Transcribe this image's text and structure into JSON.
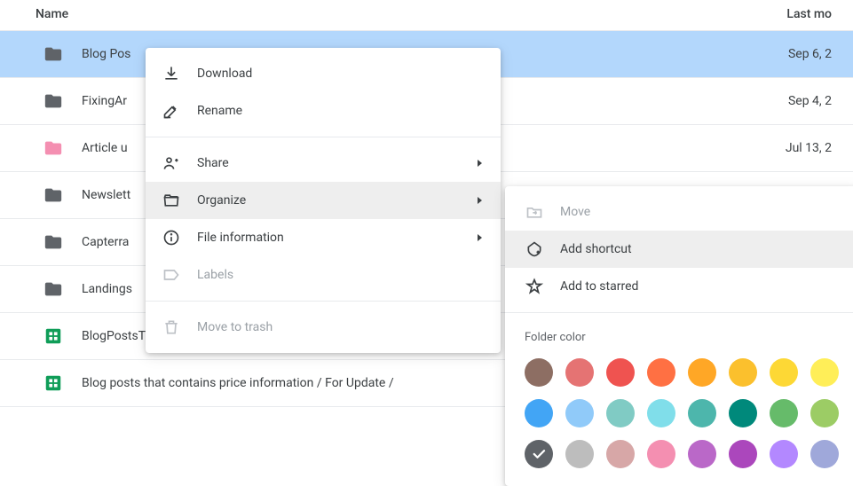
{
  "header": {
    "name_label": "Name",
    "modified_label": "Last mo"
  },
  "rows": [
    {
      "name": "Blog Pos",
      "date": "Sep 6, 2",
      "iconType": "folder",
      "iconColor": "#5f6368",
      "selected": true
    },
    {
      "name": "FixingAr",
      "date": "Sep 4, 2",
      "iconType": "folder",
      "iconColor": "#5f6368"
    },
    {
      "name": "Article u",
      "date": "Jul 13, 2",
      "iconType": "folder",
      "iconColor": "#f48fb1"
    },
    {
      "name": "Newslett",
      "date": "",
      "iconType": "folder",
      "iconColor": "#5f6368"
    },
    {
      "name": "Capterra",
      "date": "",
      "iconType": "folder",
      "iconColor": "#5f6368"
    },
    {
      "name": "Landings",
      "date": "",
      "iconType": "folder",
      "iconColor": "#5f6368"
    },
    {
      "name": "BlogPostsTopics",
      "date": "",
      "iconType": "sheet",
      "iconColor": "#0f9d58"
    },
    {
      "name": "Blog posts that contains price information / For Update / ",
      "date": "",
      "iconType": "sheet",
      "iconColor": "#0f9d58"
    }
  ],
  "context_menu": {
    "download": "Download",
    "rename": "Rename",
    "share": "Share",
    "organize": "Organize",
    "file_info": "File information",
    "labels": "Labels",
    "move_to_trash": "Move to trash"
  },
  "submenu": {
    "move": "Move",
    "add_shortcut": "Add shortcut",
    "add_to_starred": "Add to starred",
    "folder_color": "Folder color"
  },
  "colors": [
    "#8d6e63",
    "#e57373",
    "#ef5350",
    "#ff7043",
    "#ffa726",
    "#fbc02d",
    "#fdd835",
    "#ffee58",
    "#42a5f5",
    "#90caf9",
    "#80cbc4",
    "#80deea",
    "#4db6ac",
    "#00897b",
    "#66bb6a",
    "#9ccc65",
    "#5f6368",
    "#bdbdbd",
    "#d7a7a7",
    "#f48fb1",
    "#ba68c8",
    "#ab47bc",
    "#b388ff",
    "#9fa8da"
  ],
  "selected_color_index": 16
}
